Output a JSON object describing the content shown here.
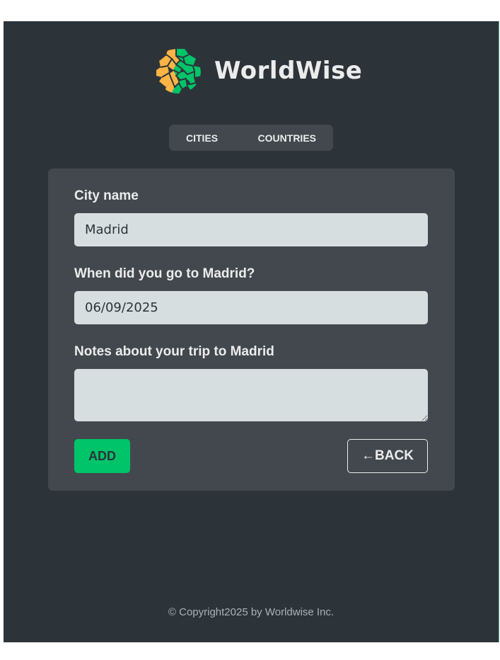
{
  "brand": {
    "name": "WorldWise",
    "logo_icon": "globe-logo-icon",
    "colors": {
      "orange": "#ffb545",
      "green": "#00c46a",
      "background": "#2d3439",
      "panel": "#42484d"
    }
  },
  "nav": {
    "items": [
      {
        "label": "Cities"
      },
      {
        "label": "Countries"
      }
    ]
  },
  "form": {
    "city_name_label": "City name",
    "city_name_value": "Madrid",
    "date_label": "When did you go to Madrid?",
    "date_value": "06/09/2025",
    "notes_label": "Notes about your trip to Madrid",
    "notes_value": "",
    "add_label": "Add",
    "back_label": "←BACK",
    "back_icon": "left-arrow-icon"
  },
  "footer": {
    "text": "© Copyright2025 by Worldwise Inc."
  }
}
